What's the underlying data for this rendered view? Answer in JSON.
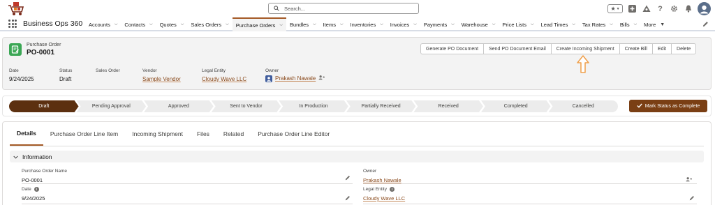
{
  "search": {
    "placeholder": "Search..."
  },
  "app": {
    "name": "Business Ops 360"
  },
  "nav": {
    "items": [
      {
        "label": "Accounts"
      },
      {
        "label": "Contacts"
      },
      {
        "label": "Quotes"
      },
      {
        "label": "Sales Orders"
      },
      {
        "label": "Purchase Orders"
      },
      {
        "label": "Bundles"
      },
      {
        "label": "Items"
      },
      {
        "label": "Inventories"
      },
      {
        "label": "Invoices"
      },
      {
        "label": "Payments"
      },
      {
        "label": "Warehouse"
      },
      {
        "label": "Price Lists"
      },
      {
        "label": "Lead Times"
      },
      {
        "label": "Tax Rates"
      },
      {
        "label": "Bills"
      }
    ],
    "more_label": "More",
    "active": "Purchase Orders"
  },
  "record": {
    "type": "Purchase Order",
    "title": "PO-0001",
    "actions": [
      {
        "label": "Generate PO Document"
      },
      {
        "label": "Send PO Document Email"
      },
      {
        "label": "Create Incoming Shipment"
      },
      {
        "label": "Create Bill"
      },
      {
        "label": "Edit"
      },
      {
        "label": "Delete"
      }
    ],
    "fields": {
      "date": {
        "label": "Date",
        "value": "9/24/2025"
      },
      "status": {
        "label": "Status",
        "value": "Draft"
      },
      "sales_order": {
        "label": "Sales Order",
        "value": ""
      },
      "vendor": {
        "label": "Vendor",
        "value": "Sample Vendor"
      },
      "legal_entity": {
        "label": "Legal Entity",
        "value": "Cloudy Wave LLC"
      },
      "owner": {
        "label": "Owner",
        "value": "Prakash Nawale"
      }
    }
  },
  "path": {
    "stages": [
      {
        "label": "Draft"
      },
      {
        "label": "Pending Approval"
      },
      {
        "label": "Approved"
      },
      {
        "label": "Sent to Vendor"
      },
      {
        "label": "In Production"
      },
      {
        "label": "Partially Received"
      },
      {
        "label": "Received"
      },
      {
        "label": "Completed"
      },
      {
        "label": "Cancelled"
      }
    ],
    "current": "Draft",
    "mark_button": "Mark Status as Complete"
  },
  "tabs": [
    {
      "label": "Details"
    },
    {
      "label": "Purchase Order Line Item"
    },
    {
      "label": "Incoming Shipment"
    },
    {
      "label": "Files"
    },
    {
      "label": "Related"
    },
    {
      "label": "Purchase Order Line Editor"
    }
  ],
  "active_tab": "Details",
  "information": {
    "title": "Information",
    "fields": {
      "po_name": {
        "label": "Purchase Order Name",
        "value": "PO-0001"
      },
      "owner": {
        "label": "Owner",
        "value": "Prakash Nawale"
      },
      "date": {
        "label": "Date",
        "value": "9/24/2025"
      },
      "legal_entity": {
        "label": "Legal Entity",
        "value": "Cloudy Wave LLC"
      }
    }
  },
  "colors": {
    "accent": "#a45a26",
    "path_current": "#5c3010",
    "mark_button": "#7a3f14",
    "link": "#8a4a1c",
    "record_icon": "#3ba755",
    "arrow": "#f0a04b"
  }
}
